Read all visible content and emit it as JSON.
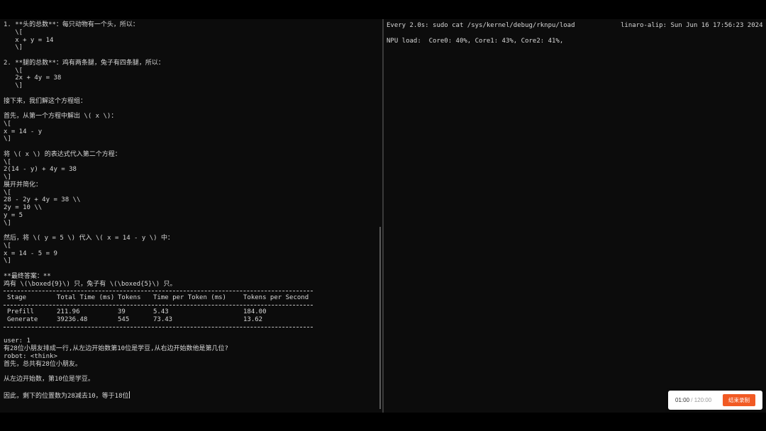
{
  "left_terminal": {
    "lines": [
      "1. **头的总数**：每只动物有一个头，所以：",
      "   \\[",
      "   x + y = 14",
      "   \\]",
      "",
      "2. **腿的总数**：鸡有两条腿，兔子有四条腿，所以：",
      "   \\[",
      "   2x + 4y = 38",
      "   \\]",
      "",
      "接下来，我们解这个方程组：",
      "",
      "首先，从第一个方程中解出 \\( x \\)：",
      "\\[",
      "x = 14 - y",
      "\\]",
      "",
      "将 \\( x \\) 的表达式代入第二个方程：",
      "\\[",
      "2(14 - y) + 4y = 38",
      "\\]",
      "展开并简化：",
      "\\[",
      "28 - 2y + 4y = 38 \\\\",
      "2y = 10 \\\\",
      "y = 5",
      "\\]",
      "",
      "然后，将 \\( y = 5 \\) 代入 \\( x = 14 - y \\) 中：",
      "\\[",
      "x = 14 - 5 = 9",
      "\\]",
      "",
      "**最终答案：**",
      "鸡有 \\(\\boxed{9}\\) 只，兔子有 \\(\\boxed{5}\\) 只。"
    ],
    "stats_table": {
      "headers": [
        "Stage",
        "Total Time (ms)",
        "Tokens",
        "Time per Token (ms)",
        "Tokens per Second"
      ],
      "rows": [
        [
          "Prefill",
          "211.96",
          "39",
          "5.43",
          "184.00"
        ],
        [
          "Generate",
          "39236.48",
          "545",
          "73.43",
          "13.62"
        ]
      ]
    },
    "after_lines": [
      "",
      "user: 1",
      "有28位小朋友排成一行,从左边开始数第10位是学豆,从右边开始数他是第几位?",
      "robot: <think>",
      "首先，总共有28位小朋友。",
      "",
      "从左边开始数，第10位是学豆。",
      "",
      "因此，剩下的位置数为28减去10，等于18位"
    ]
  },
  "right_terminal": {
    "watch_command": "Every 2.0s: sudo cat /sys/kernel/debug/rknpu/load",
    "host_time": "linaro-alip: Sun Jun 16 17:56:23 2024",
    "npu_load": "NPU load:  Core0: 40%, Core1: 43%, Core2: 41%,"
  },
  "recorder": {
    "elapsed": "01:00",
    "separator": " / ",
    "total": "120:00",
    "stop_label": "结束录制"
  },
  "colors": {
    "terminal_bg": "#0c0c0c",
    "terminal_text": "#d8d8d8",
    "stop_button": "#f15a24"
  }
}
